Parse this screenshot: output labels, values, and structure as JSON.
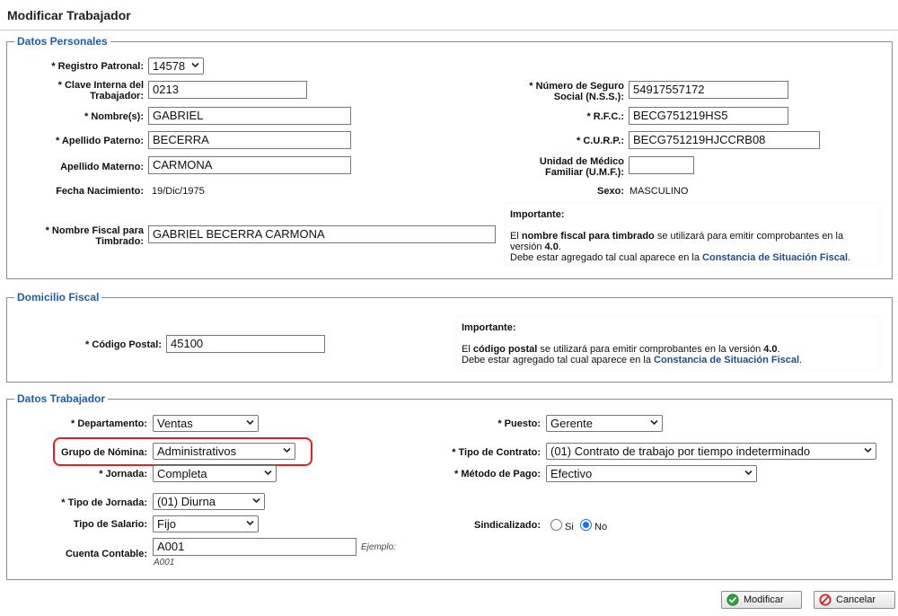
{
  "page": {
    "title": "Modificar Trabajador"
  },
  "personal": {
    "legend": "Datos Personales",
    "registro_patronal": {
      "label": "* Registro Patronal:",
      "value": "14578"
    },
    "clave_interna": {
      "label_l1": "* Clave Interna del",
      "label_l2": "Trabajador:",
      "value": "0213"
    },
    "nombres": {
      "label": "* Nombre(s):",
      "value": "GABRIEL"
    },
    "apellido_paterno": {
      "label": "* Apellido Paterno:",
      "value": "BECERRA"
    },
    "apellido_materno": {
      "label": "Apellido Materno:",
      "value": "CARMONA"
    },
    "fecha_nacimiento": {
      "label": "Fecha Nacimiento:",
      "value": "19/Dic/1975"
    },
    "nombre_fiscal": {
      "label_l1": "* Nombre Fiscal para",
      "label_l2": "Timbrado:",
      "value": "GABRIEL BECERRA CARMONA"
    },
    "nss": {
      "label_l1": "* Número de Seguro",
      "label_l2": "Social (N.S.S.):",
      "value": "54917557172"
    },
    "rfc": {
      "label": "* R.F.C.:",
      "value": "BECG751219HS5"
    },
    "curp": {
      "label": "* C.U.R.P.:",
      "value": "BECG751219HJCCRB08"
    },
    "umf": {
      "label_l1": "Unidad de Médico",
      "label_l2": "Familiar (U.M.F.):",
      "value": ""
    },
    "sexo": {
      "label": "Sexo:",
      "value": "MASCULINO"
    },
    "note": {
      "title": "Importante:",
      "l1_a": "El ",
      "l1_b": "nombre fiscal para timbrado",
      "l1_c": " se utilizará para emitir comprobantes en la",
      "l2_a": "versión ",
      "l2_b": "4.0",
      "l2_c": ".",
      "l3_a": "Debe estar agregado tal cual aparece en la ",
      "l3_link": "Constancia de Situación Fiscal",
      "l3_c": "."
    }
  },
  "domicilio": {
    "legend": "Domicilio Fiscal",
    "codigo_postal": {
      "label": "* Código Postal:",
      "value": "45100"
    },
    "note": {
      "title": "Importante:",
      "l1_a": "El ",
      "l1_b": "código postal",
      "l1_c": " se utilizará para emitir comprobantes en la versión ",
      "l1_d": "4.0",
      "l1_e": ".",
      "l2_a": "Debe estar agregado tal cual aparece en la ",
      "l2_link": "Constancia de Situación Fiscal",
      "l2_c": "."
    }
  },
  "trabajador": {
    "legend": "Datos Trabajador",
    "departamento": {
      "label": "* Departamento:",
      "value": "Ventas"
    },
    "grupo_nomina": {
      "label": "Grupo de Nómina:",
      "value": "Administrativos"
    },
    "jornada": {
      "label": "* Jornada:",
      "value": "Completa"
    },
    "tipo_jornada": {
      "label": "* Tipo de Jornada:",
      "value": "(01) Diurna"
    },
    "tipo_salario": {
      "label": "Tipo de Salario:",
      "value": "Fijo"
    },
    "cuenta_contable": {
      "label": "Cuenta Contable:",
      "value": "A001",
      "hint_l1": "Ejemplo:",
      "hint_l2": "A001"
    },
    "puesto": {
      "label": "* Puesto:",
      "value": "Gerente"
    },
    "tipo_contrato": {
      "label": "* Tipo de Contrato:",
      "value": "(01) Contrato de trabajo por tiempo indeterminado"
    },
    "metodo_pago": {
      "label": "* Método de Pago:",
      "value": "Efectivo"
    },
    "sindicalizado": {
      "label": "Sindicalizado:",
      "option_si": "Si",
      "option_no": "No",
      "selected": "No"
    }
  },
  "actions": {
    "modificar": "Modificar",
    "cancelar": "Cancelar"
  },
  "colors": {
    "legend": "#1f5fa8",
    "highlight": "#e02020",
    "radio": "#1a73e8",
    "ok_icon": "#2e9e3a",
    "cancel_icon": "#d42020"
  }
}
